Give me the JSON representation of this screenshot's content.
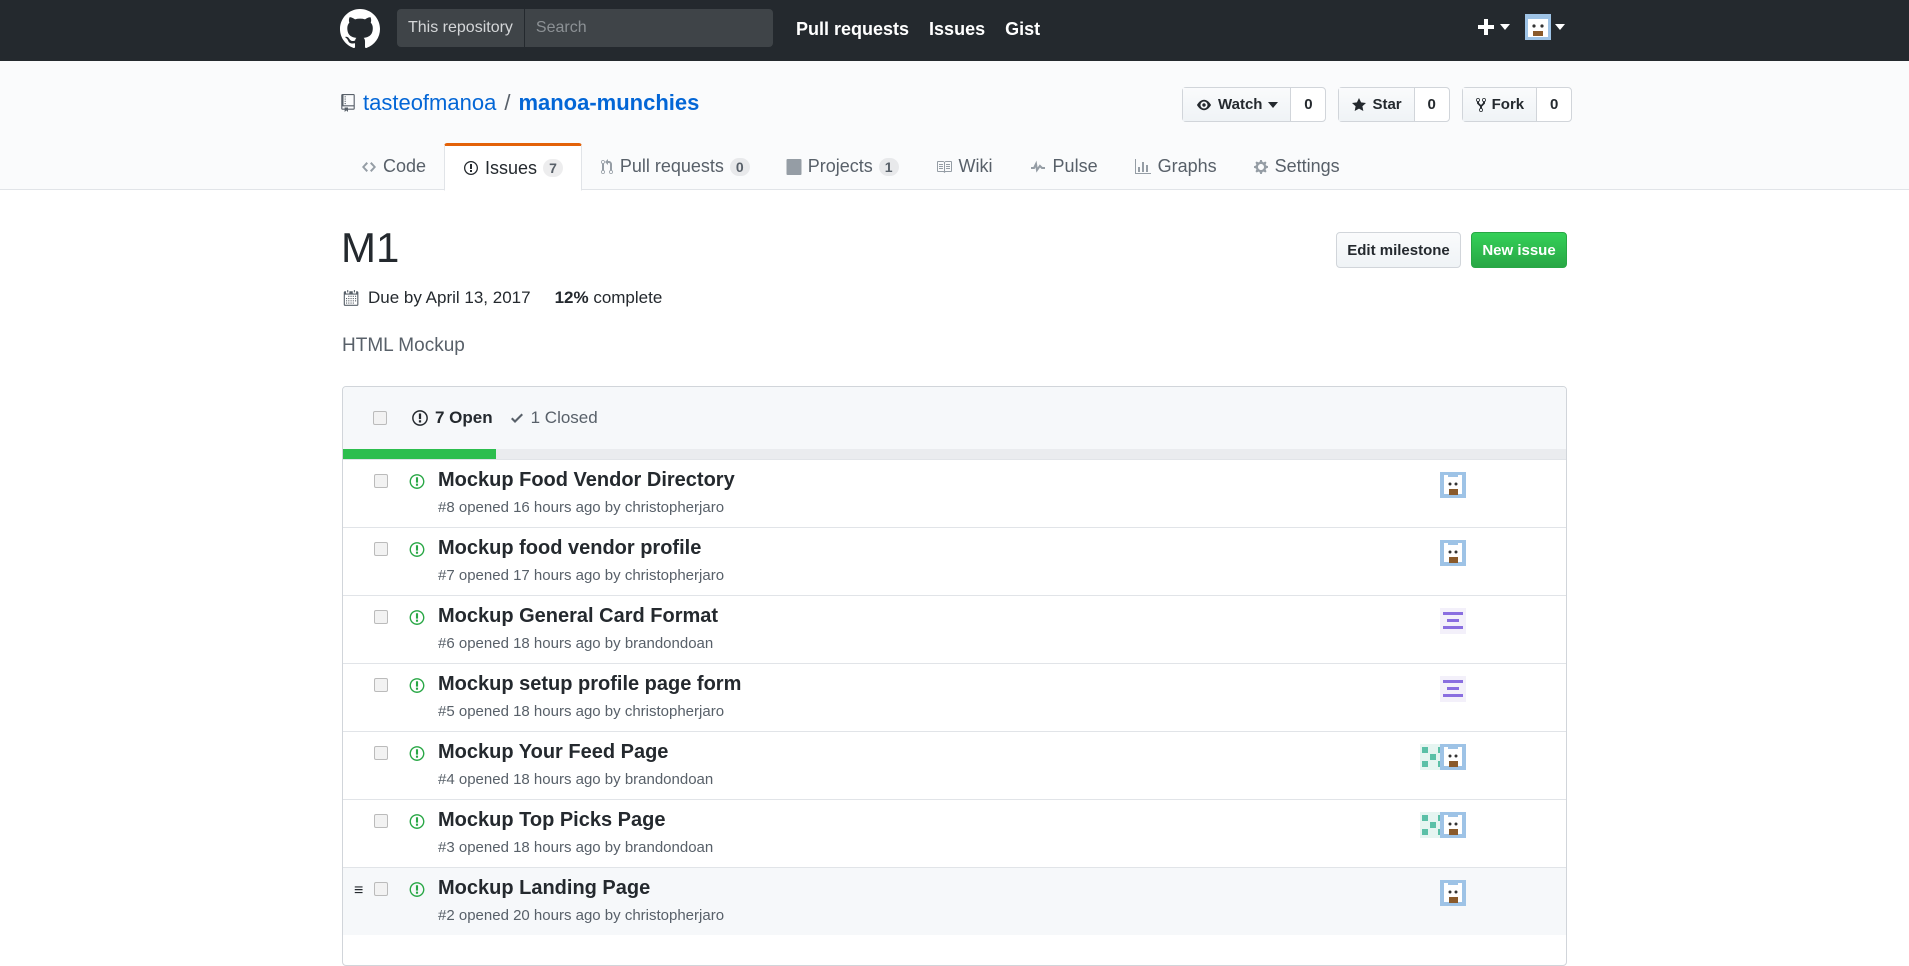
{
  "header": {
    "search_scope": "This repository",
    "search_placeholder": "Search",
    "nav": [
      "Pull requests",
      "Issues",
      "Gist"
    ],
    "plus_icon": "plus-icon",
    "colors": {
      "bg": "#24292e"
    }
  },
  "repo": {
    "owner": "tasteofmanoa",
    "separator": "/",
    "name": "manoa-munchies",
    "watch_label": "Watch",
    "watch_count": "0",
    "star_label": "Star",
    "star_count": "0",
    "fork_label": "Fork",
    "fork_count": "0"
  },
  "tabs": [
    {
      "label": "Code",
      "icon": "code-icon"
    },
    {
      "label": "Issues",
      "counter": "7",
      "icon": "issue-icon",
      "selected": true
    },
    {
      "label": "Pull requests",
      "counter": "0",
      "icon": "pr-icon"
    },
    {
      "label": "Projects",
      "counter": "1",
      "icon": "project-icon"
    },
    {
      "label": "Wiki",
      "icon": "book-icon"
    },
    {
      "label": "Pulse",
      "icon": "pulse-icon"
    },
    {
      "label": "Graphs",
      "icon": "graph-icon"
    },
    {
      "label": "Settings",
      "icon": "gear-icon"
    }
  ],
  "milestone": {
    "title": "M1",
    "edit_label": "Edit milestone",
    "new_issue_label": "New issue",
    "due": "Due by April 13, 2017",
    "percent": "12%",
    "percent_suffix": " complete",
    "progress_fraction": 0.125,
    "description": "HTML Mockup"
  },
  "states": {
    "open": "7 Open",
    "closed": "1 Closed"
  },
  "issues": [
    {
      "title": "Mockup Food Vendor Directory",
      "meta": "#8 opened 16 hours ago by christopherjaro",
      "assignees": [
        "cat"
      ]
    },
    {
      "title": "Mockup food vendor profile",
      "meta": "#7 opened 17 hours ago by christopherjaro",
      "assignees": [
        "cat"
      ]
    },
    {
      "title": "Mockup General Card Format",
      "meta": "#6 opened 18 hours ago by brandondoan",
      "assignees": [
        "purple"
      ]
    },
    {
      "title": "Mockup setup profile page form",
      "meta": "#5 opened 18 hours ago by christopherjaro",
      "assignees": [
        "purple"
      ]
    },
    {
      "title": "Mockup Your Feed Page",
      "meta": "#4 opened 18 hours ago by brandondoan",
      "assignees": [
        "teal",
        "cat"
      ]
    },
    {
      "title": "Mockup Top Picks Page",
      "meta": "#3 opened 18 hours ago by brandondoan",
      "assignees": [
        "teal",
        "cat"
      ]
    },
    {
      "title": "Mockup Landing Page",
      "meta": "#2 opened 20 hours ago by christopherjaro",
      "assignees": [
        "cat"
      ],
      "highlighted": true
    }
  ]
}
